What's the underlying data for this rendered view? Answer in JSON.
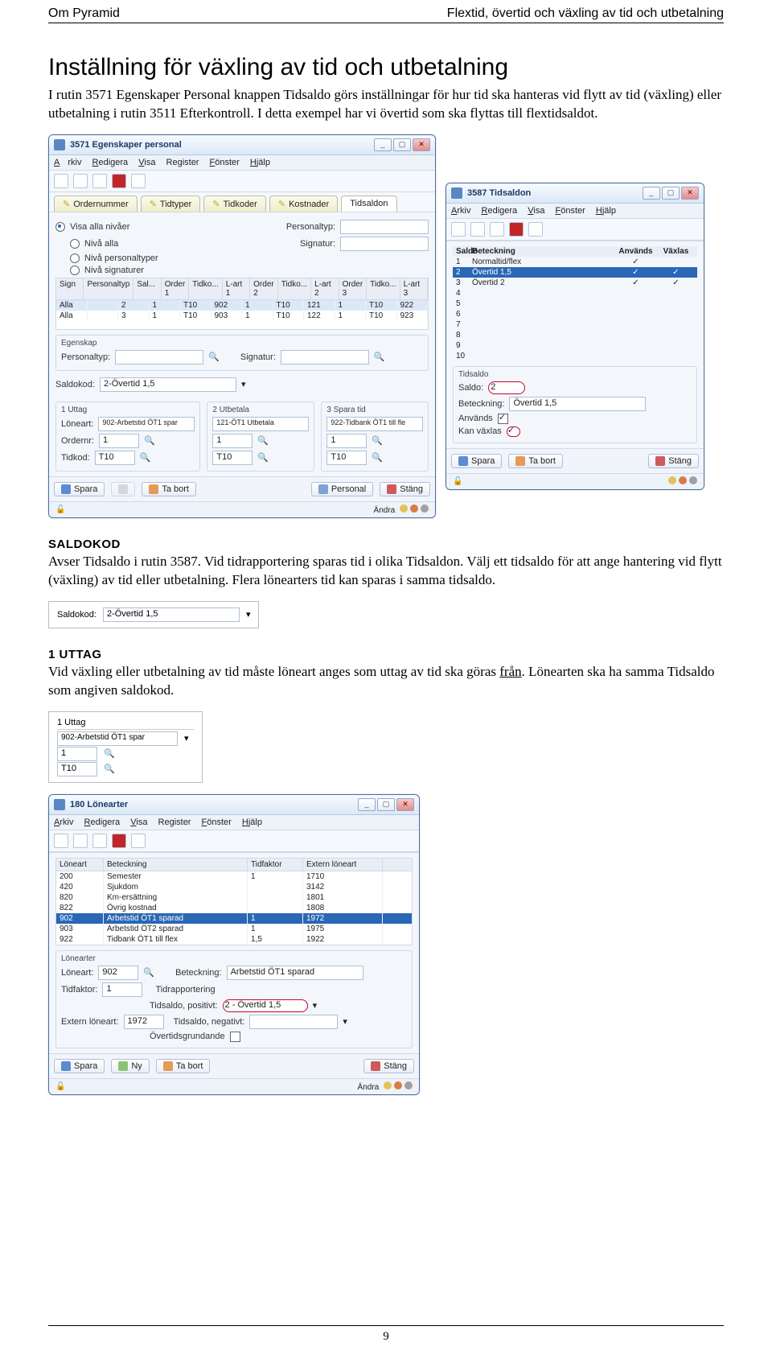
{
  "header": {
    "left": "Om Pyramid",
    "right": "Flextid, övertid och växling av tid och utbetalning"
  },
  "title": "Inställning för växling av tid och utbetalning",
  "intro": "I rutin 3571 Egenskaper Personal knappen Tidsaldo görs inställningar för hur tid ska hanteras vid flytt av tid (växling) eller utbetalning i rutin 3511 Efterkontroll. I detta exempel har vi övertid som ska flyttas till flextidsaldot.",
  "win3571": {
    "title": "3571 Egenskaper personal",
    "menu": [
      "Arkiv",
      "Redigera",
      "Visa",
      "Register",
      "Fönster",
      "Hjälp"
    ],
    "tabs": [
      "Ordernummer",
      "Tidtyper",
      "Tidkoder",
      "Kostnader",
      "Tidsaldon"
    ],
    "radios": [
      "Visa alla nivåer",
      "Nivå alla",
      "Nivå personaltyper",
      "Nivå signaturer"
    ],
    "lab_personaltyp": "Personaltyp:",
    "lab_signatur": "Signatur:",
    "grid_cols": [
      "Sign",
      "Personaltyp",
      "Sal...",
      "Order 1",
      "Tidko...",
      "L-art 1",
      "Order 2",
      "Tidko...",
      "L-art 2",
      "Order 3",
      "Tidko...",
      "L-art 3"
    ],
    "grid_rows": [
      [
        "Alla",
        "",
        "2",
        "1",
        "T10",
        "902",
        "1",
        "T10",
        "121",
        "1",
        "T10",
        "922"
      ],
      [
        "Alla",
        "",
        "3",
        "1",
        "T10",
        "903",
        "1",
        "T10",
        "122",
        "1",
        "T10",
        "923"
      ]
    ],
    "group_egenskap": "Egenskap",
    "saldokod_label": "Saldokod:",
    "saldokod_value": "2-Övertid 1,5",
    "sub_tabs": [
      "1 Uttag",
      "2 Utbetala",
      "3 Spara tid"
    ],
    "loneart_label": "Löneart:",
    "loneart_vals": [
      "902-Arbetstid ÖT1 spar",
      "121-ÖT1 Utbetala",
      "922-Tidbank ÖT1 till fle"
    ],
    "ordernr_label": "Ordernr:",
    "ordernr_vals": [
      "1",
      "1",
      "1"
    ],
    "tidkod_label": "Tidkod:",
    "tidkod_vals": [
      "T10",
      "T10",
      "T10"
    ],
    "btns": {
      "spara": "Spara",
      "tabort": "Ta bort",
      "personal": "Personal",
      "stang": "Stäng"
    },
    "status_andra": "Ändra"
  },
  "win3587": {
    "title": "3587 Tidsaldon",
    "menu": [
      "Arkiv",
      "Redigera",
      "Visa",
      "Fönster",
      "Hjälp"
    ],
    "cols": [
      "Saldo",
      "Beteckning",
      "Används",
      "Växlas"
    ],
    "rows": [
      {
        "n": "1",
        "b": "Normaltid/flex",
        "a": true,
        "v": false
      },
      {
        "n": "2",
        "b": "Övertid 1,5",
        "a": true,
        "v": true,
        "sel": true
      },
      {
        "n": "3",
        "b": "Övertid 2",
        "a": true,
        "v": true
      },
      {
        "n": "4",
        "b": "",
        "a": false,
        "v": false
      },
      {
        "n": "5",
        "b": "",
        "a": false,
        "v": false
      },
      {
        "n": "6",
        "b": "",
        "a": false,
        "v": false
      },
      {
        "n": "7",
        "b": "",
        "a": false,
        "v": false
      },
      {
        "n": "8",
        "b": "",
        "a": false,
        "v": false
      },
      {
        "n": "9",
        "b": "",
        "a": false,
        "v": false
      },
      {
        "n": "10",
        "b": "",
        "a": false,
        "v": false
      }
    ],
    "group": "Tidsaldo",
    "saldo_label": "Saldo:",
    "saldo_value": "2",
    "beteckning_label": "Beteckning:",
    "beteckning_value": "Övertid 1,5",
    "anvands_label": "Används",
    "kanvaxlas_label": "Kan växlas",
    "btns": {
      "spara": "Spara",
      "tabort": "Ta bort",
      "stang": "Stäng"
    }
  },
  "saldokod_h": "SALDOKOD",
  "saldokod_p": "Avser Tidsaldo i rutin 3587. Vid tidrapportering sparas tid i olika Tidsaldon. Välj ett tidsaldo för att ange hantering vid flytt (växling) av tid eller utbetalning. Flera lönearters tid kan sparas i samma tidsaldo.",
  "snip_saldokod": {
    "label": "Saldokod:",
    "value": "2-Övertid 1,5"
  },
  "uttag_h": "1 UTTAG",
  "uttag_p1": "Vid växling eller utbetalning av tid måste löneart anges som uttag av tid ska göras ",
  "uttag_p_from": "från",
  "uttag_p2": ". Lönearten ska ha samma Tidsaldo som angiven saldokod.",
  "snip_uttag": {
    "title": "1 Uttag",
    "rows": [
      "902-Arbetstid ÖT1 spar",
      "1",
      "T10"
    ]
  },
  "win180": {
    "title": "180 Lönearter",
    "menu": [
      "Arkiv",
      "Redigera",
      "Visa",
      "Register",
      "Fönster",
      "Hjälp"
    ],
    "cols": [
      "Löneart",
      "Beteckning",
      "Tidfaktor",
      "Extern löneart"
    ],
    "rows": [
      [
        "200",
        "Semester",
        "1",
        "1710"
      ],
      [
        "420",
        "Sjukdom",
        "",
        "3142"
      ],
      [
        "820",
        "Km-ersättning",
        "",
        "1801"
      ],
      [
        "822",
        "Övrig kostnad",
        "",
        "1808"
      ],
      [
        "902",
        "Arbetstid ÖT1 sparad",
        "1",
        "1972",
        "sel"
      ],
      [
        "903",
        "Arbetstid ÖT2 sparad",
        "1",
        "1975"
      ],
      [
        "922",
        "Tidbank ÖT1 till flex",
        "1,5",
        "1922"
      ]
    ],
    "group": "Lönearter",
    "loneart_label": "Löneart:",
    "loneart_val": "902",
    "beteckning_label": "Beteckning:",
    "beteckning_val": "Arbetstid ÖT1 sparad",
    "tidfaktor_label": "Tidfaktor:",
    "tidfaktor_val": "1",
    "extern_label": "Extern löneart:",
    "extern_val": "1972",
    "tidrapportering": "Tidrapportering",
    "tidsaldo_pos_label": "Tidsaldo, positivt:",
    "tidsaldo_pos_val": "2 - Övertid 1,5",
    "tidsaldo_neg_label": "Tidsaldo, negativt:",
    "overtid_label": "Övertidsgrundande",
    "btns": {
      "spara": "Spara",
      "ny": "Ny",
      "tabort": "Ta bort",
      "stang": "Stäng"
    },
    "status_andra": "Ändra"
  },
  "page_number": "9"
}
